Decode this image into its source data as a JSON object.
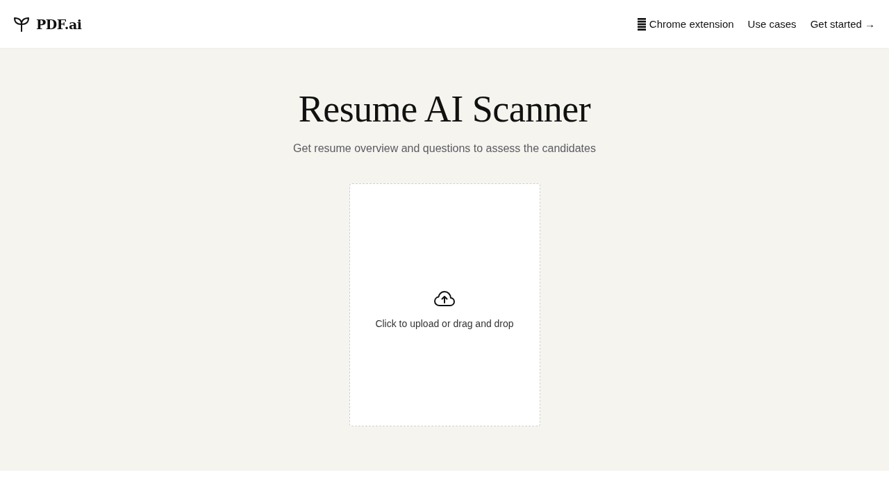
{
  "header": {
    "logo": "PDF.ai",
    "nav": [
      {
        "kind": "icon",
        "label": "Chrome extension"
      },
      {
        "kind": "plain",
        "label": "Use cases"
      },
      {
        "kind": "plain",
        "label": "Get started →"
      }
    ]
  },
  "hero": {
    "title": "Resume AI Scanner",
    "subtitle": "Get resume overview and questions to assess the candidates"
  },
  "upload": {
    "prompt": "Click to upload or drag and drop"
  }
}
